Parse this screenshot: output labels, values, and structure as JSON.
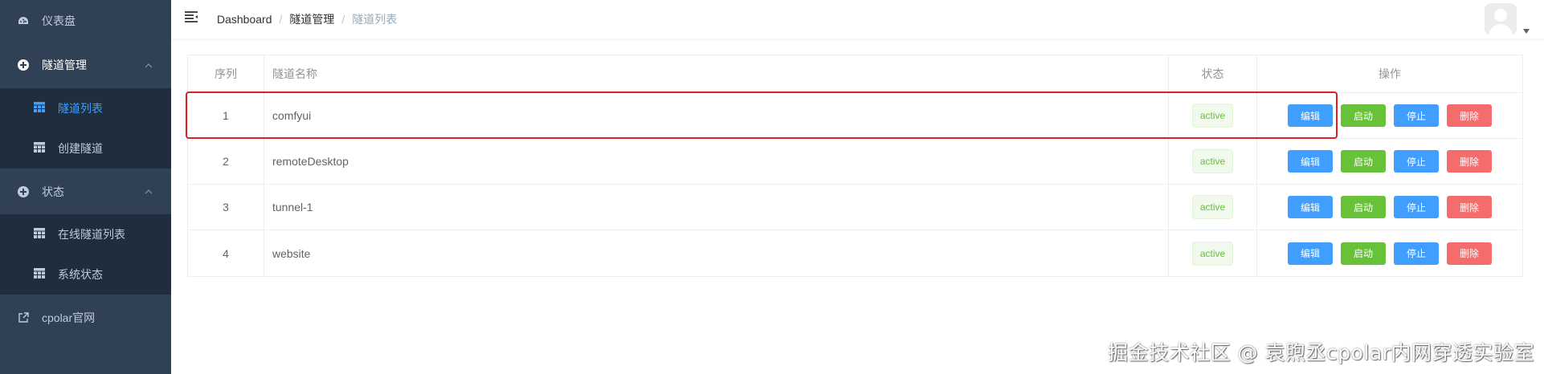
{
  "sidebar": {
    "items": [
      {
        "label": "仪表盘",
        "icon": "dashboard-icon"
      },
      {
        "label": "隧道管理",
        "icon": "circle-plus-icon",
        "expanded": true,
        "children": [
          {
            "label": "隧道列表",
            "icon": "table-icon",
            "active": true
          },
          {
            "label": "创建隧道",
            "icon": "table-icon"
          }
        ]
      },
      {
        "label": "状态",
        "icon": "circle-plus-icon",
        "expanded": true,
        "children": [
          {
            "label": "在线隧道列表",
            "icon": "table-icon"
          },
          {
            "label": "系统状态",
            "icon": "table-icon"
          }
        ]
      },
      {
        "label": "cpolar官网",
        "icon": "external-link-icon"
      }
    ]
  },
  "breadcrumb": [
    "Dashboard",
    "隧道管理",
    "隧道列表"
  ],
  "table": {
    "headers": [
      "序列",
      "隧道名称",
      "状态",
      "操作"
    ],
    "rows": [
      {
        "idx": "1",
        "name": "comfyui",
        "status": "active"
      },
      {
        "idx": "2",
        "name": "remoteDesktop",
        "status": "active"
      },
      {
        "idx": "3",
        "name": "tunnel-1",
        "status": "active"
      },
      {
        "idx": "4",
        "name": "website",
        "status": "active"
      }
    ],
    "actions": {
      "edit": "编辑",
      "start": "启动",
      "stop": "停止",
      "delete": "删除"
    }
  },
  "watermark": "掘金技术社区 @ 袁煦丞cpolar内网穿透实验室",
  "colors": {
    "sidebar": "#304156",
    "submenu": "#1f2d3d",
    "primary": "#409eff",
    "success": "#67c23a",
    "danger": "#f56c6c",
    "highlight": "#e02020"
  }
}
